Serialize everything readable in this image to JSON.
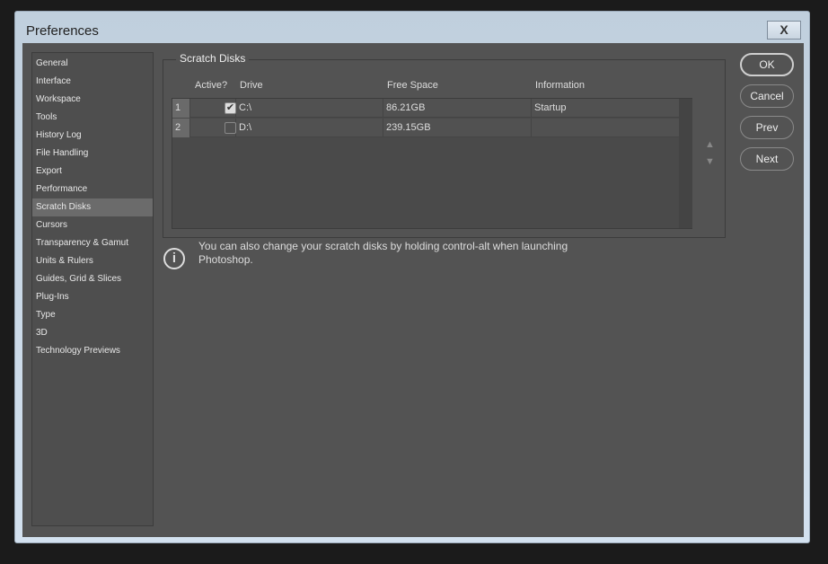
{
  "window": {
    "title": "Preferences",
    "close_label": "X"
  },
  "sidebar": {
    "items": [
      "General",
      "Interface",
      "Workspace",
      "Tools",
      "History Log",
      "File Handling",
      "Export",
      "Performance",
      "Scratch Disks",
      "Cursors",
      "Transparency & Gamut",
      "Units & Rulers",
      "Guides, Grid & Slices",
      "Plug-Ins",
      "Type",
      "3D",
      "Technology Previews"
    ],
    "selected": "Scratch Disks"
  },
  "group": {
    "title": "Scratch Disks",
    "headers": {
      "active": "Active?",
      "drive": "Drive",
      "free": "Free Space",
      "info": "Information"
    },
    "rows": [
      {
        "num": "1",
        "active": true,
        "drive": "C:\\",
        "free": "86.21GB",
        "info": "Startup"
      },
      {
        "num": "2",
        "active": false,
        "drive": "D:\\",
        "free": "239.15GB",
        "info": ""
      }
    ]
  },
  "note": "You can also change your scratch disks by holding control-alt when launching Photoshop.",
  "buttons": {
    "ok": "OK",
    "cancel": "Cancel",
    "prev": "Prev",
    "next": "Next"
  }
}
